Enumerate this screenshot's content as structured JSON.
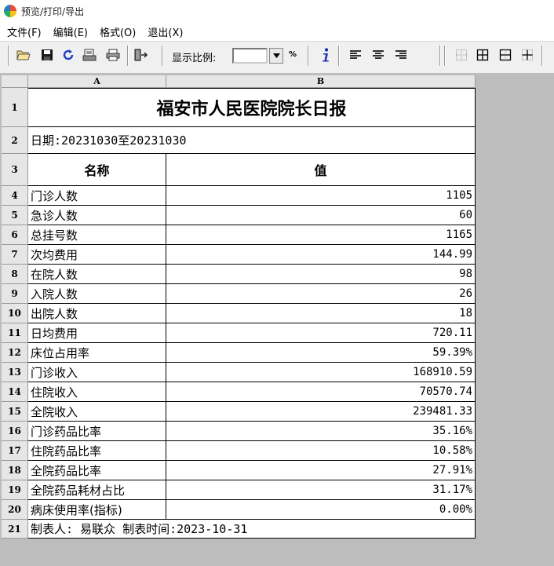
{
  "window": {
    "title": "预览/打印/导出"
  },
  "menu": [
    "文件(F)",
    "编辑(E)",
    "格式(O)",
    "退出(X)"
  ],
  "toolbar": {
    "zoom_label": "显示比例:",
    "zoom_value": "",
    "zoom_unit": "%"
  },
  "sheet": {
    "columns": [
      "A",
      "B"
    ],
    "title": "福安市人民医院院长日报",
    "date_line": "日期:20231030至20231030",
    "header": {
      "name": "名称",
      "value": "值"
    },
    "rows": [
      {
        "name": "门诊人数",
        "value": "1105"
      },
      {
        "name": "急诊人数",
        "value": "60"
      },
      {
        "name": "总挂号数",
        "value": "1165"
      },
      {
        "name": "次均费用",
        "value": "144.99"
      },
      {
        "name": "在院人数",
        "value": "98"
      },
      {
        "name": "入院人数",
        "value": "26"
      },
      {
        "name": "出院人数",
        "value": "18"
      },
      {
        "name": "日均费用",
        "value": "720.11"
      },
      {
        "name": "床位占用率",
        "value": "59.39%"
      },
      {
        "name": "门诊收入",
        "value": "168910.59"
      },
      {
        "name": "住院收入",
        "value": "70570.74"
      },
      {
        "name": "全院收入",
        "value": "239481.33"
      },
      {
        "name": "门诊药品比率",
        "value": "35.16%"
      },
      {
        "name": "住院药品比率",
        "value": "10.58%"
      },
      {
        "name": "全院药品比率",
        "value": "27.91%"
      },
      {
        "name": "全院药品耗材占比",
        "value": "31.17%"
      },
      {
        "name": "病床使用率(指标)",
        "value": "0.00%"
      }
    ],
    "footer": "制表人: 易联众 制表时间:2023-10-31",
    "row_numbers": [
      "1",
      "2",
      "3",
      "4",
      "5",
      "6",
      "7",
      "8",
      "9",
      "10",
      "11",
      "12",
      "13",
      "14",
      "15",
      "16",
      "17",
      "18",
      "19",
      "20",
      "21"
    ]
  }
}
